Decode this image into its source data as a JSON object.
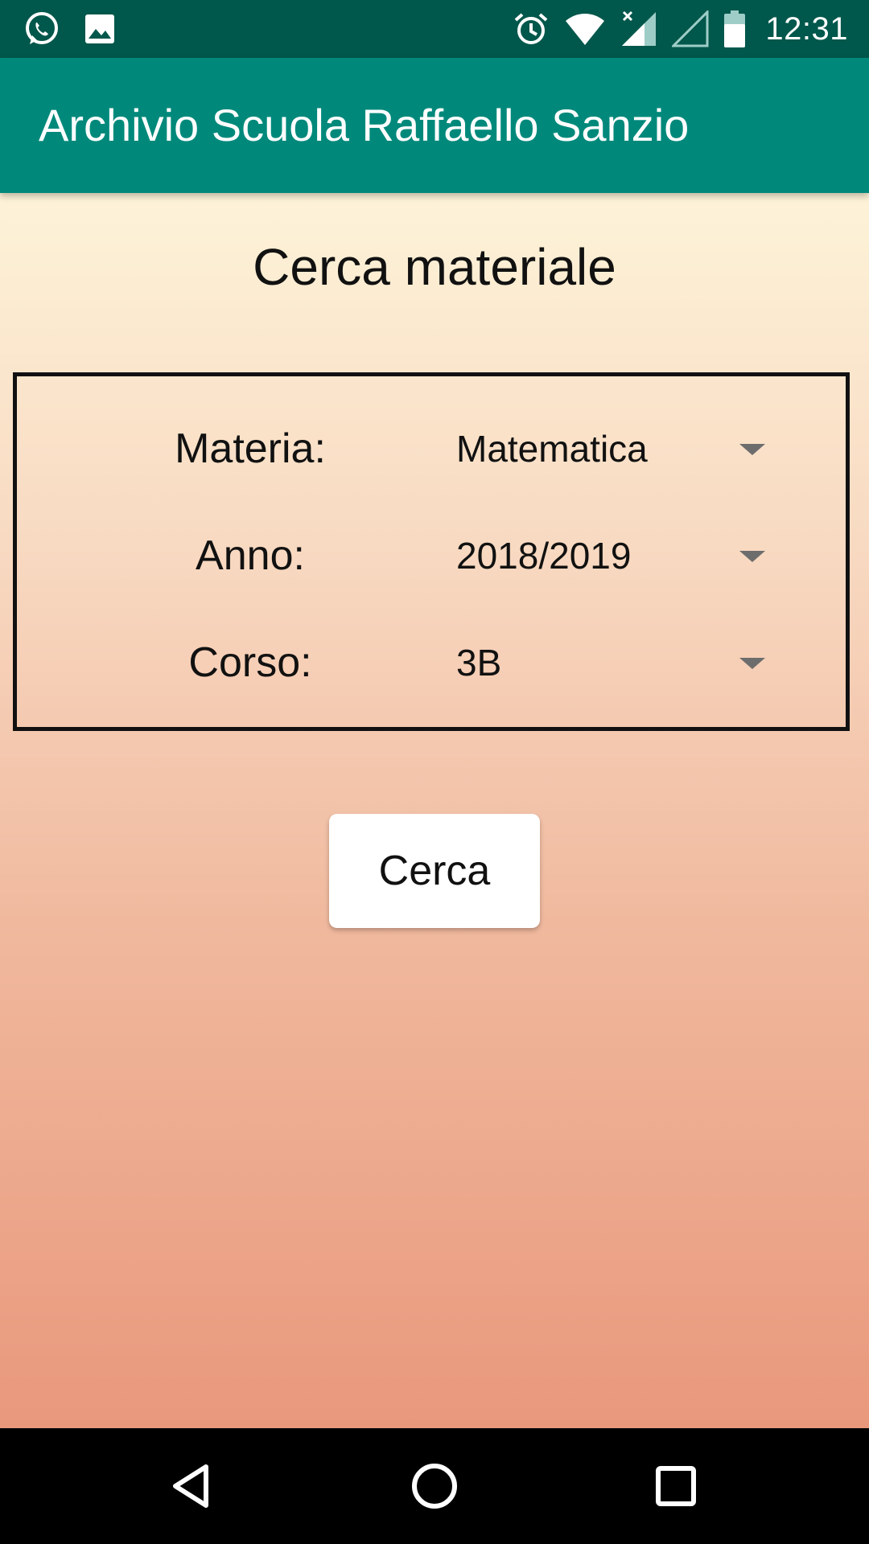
{
  "status_bar": {
    "time": "12:31",
    "left_icons": [
      "whatsapp-icon",
      "image-icon"
    ],
    "right_icons": [
      "alarm-icon",
      "wifi-icon",
      "signal-no-data-icon",
      "signal-empty-icon",
      "battery-icon"
    ],
    "background": "#00574b"
  },
  "app_bar": {
    "title": "Archivio Scuola Raffaello Sanzio",
    "background": "#00897b"
  },
  "page": {
    "title": "Cerca materiale"
  },
  "form": {
    "rows": [
      {
        "label": "Materia:",
        "value": "Matematica"
      },
      {
        "label": "Anno:",
        "value": "2018/2019"
      },
      {
        "label": "Corso:",
        "value": "3B"
      }
    ]
  },
  "search_button": {
    "label": "Cerca"
  },
  "nav_bar": {
    "buttons": [
      "back-icon",
      "home-icon",
      "recents-icon"
    ]
  }
}
